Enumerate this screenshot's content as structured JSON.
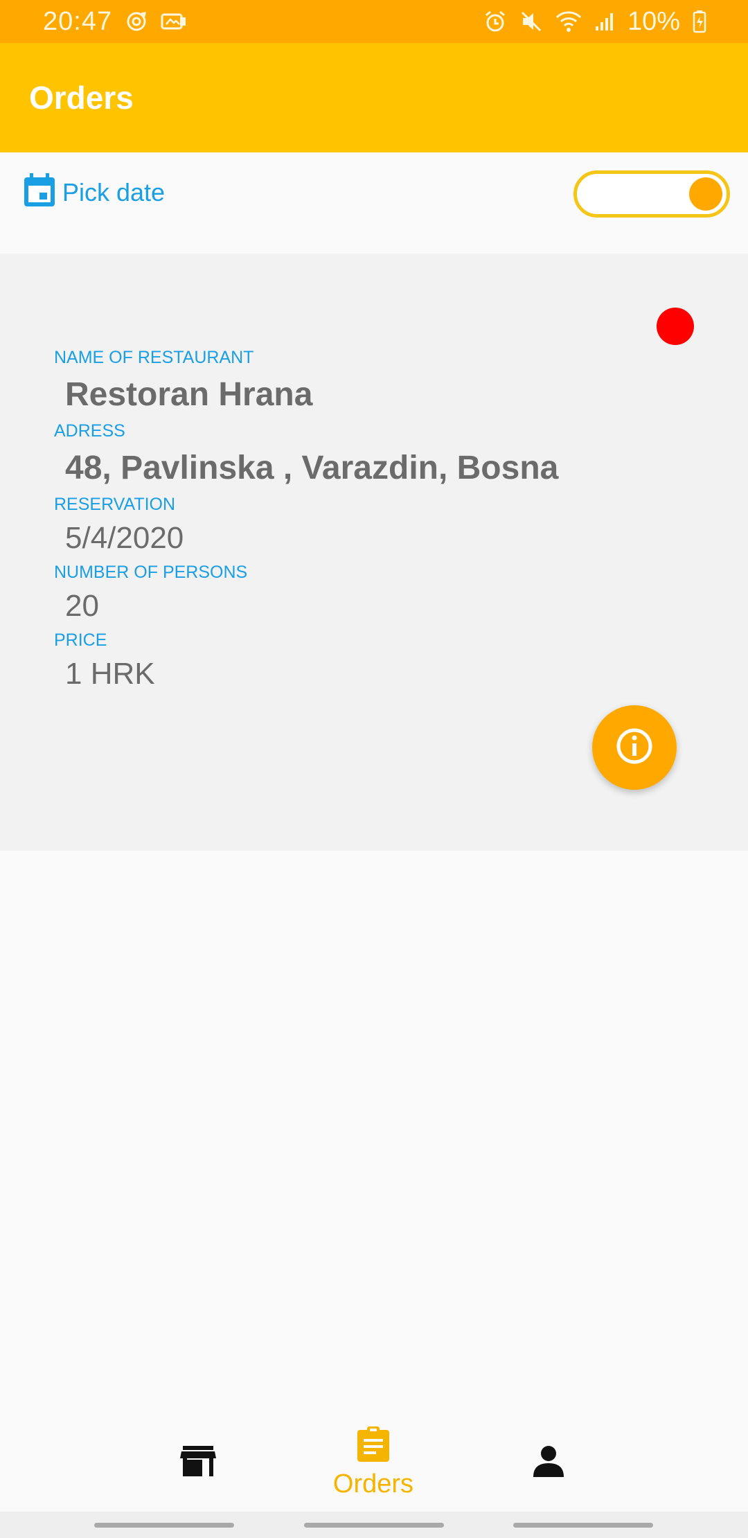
{
  "status_bar": {
    "time": "20:47",
    "battery": "10%",
    "icons": [
      "sync-icon",
      "media-icon",
      "alarm-icon",
      "mute-icon",
      "wifi-icon",
      "signal-icon",
      "battery-charging-icon"
    ]
  },
  "app_bar": {
    "title": "Orders"
  },
  "filter": {
    "pick_date_label": "Pick date",
    "toggle_on": true
  },
  "order": {
    "restaurant_label": "NAME OF RESTAURANT",
    "restaurant": "Restoran Hrana",
    "address_label": "ADRESS",
    "address": "48, Pavlinska , Varazdin, Bosna",
    "reservation_label": "RESERVATION",
    "reservation": "5/4/2020",
    "persons_label": "NUMBER OF PERSONS",
    "persons": "20",
    "price_label": "PRICE",
    "price": "1 HRK",
    "status_color": "#ff0000"
  },
  "bottom_nav": {
    "items": [
      {
        "icon": "store-icon",
        "label": ""
      },
      {
        "icon": "clipboard-icon",
        "label": "Orders",
        "active": true
      },
      {
        "icon": "person-icon",
        "label": ""
      }
    ]
  },
  "colors": {
    "status_bar": "#ffa800",
    "app_bar": "#ffc300",
    "accent_blue": "#1a9ee4",
    "fab": "#ffa800",
    "active_nav": "#f5b400"
  }
}
